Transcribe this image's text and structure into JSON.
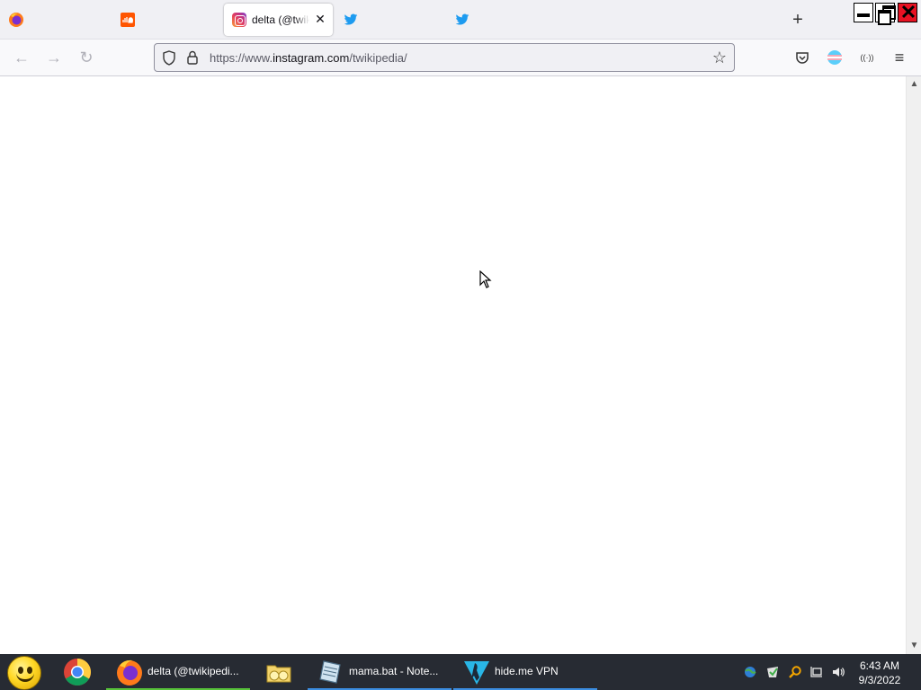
{
  "browser": {
    "tabs": [
      {
        "label": "",
        "icon": "firefox-icon",
        "active": false
      },
      {
        "label": "",
        "icon": "soundcloud-icon",
        "active": false
      },
      {
        "label": "delta (@twikipedia)",
        "icon": "instagram-icon",
        "active": true
      },
      {
        "label": "",
        "icon": "twitter-icon",
        "active": false
      },
      {
        "label": "",
        "icon": "twitter-icon",
        "active": false
      }
    ],
    "new_tab_label": "+",
    "tab_close_glyph": "✕",
    "url": {
      "prefix": "https://www.",
      "host": "instagram.com",
      "path": "/twikipedia/"
    },
    "nav": {
      "back": "←",
      "forward": "→",
      "reload": "↻",
      "star": "☆",
      "menu": "≡",
      "extension_label": "((·))"
    }
  },
  "window_controls": {
    "close_glyph": "✕"
  },
  "scrollbar": {
    "up": "▲",
    "down": "▼"
  },
  "taskbar": {
    "items": [
      {
        "label": "delta (@twikipedi...",
        "icon": "firefox-icon",
        "underline_color": "#57c23a"
      },
      {
        "label": "mama.bat - Note...",
        "icon": "notepad-icon",
        "underline_color": "#3b8de0"
      },
      {
        "label": "hide.me VPN",
        "icon": "hideme-vpn-icon",
        "underline_color": "#3b8de0"
      }
    ],
    "time": "6:43 AM",
    "date": "9/3/2022"
  },
  "colors": {
    "twitter": "#1d9bf0",
    "soundcloud": "#ff5500",
    "taskbar": "#272b33"
  }
}
